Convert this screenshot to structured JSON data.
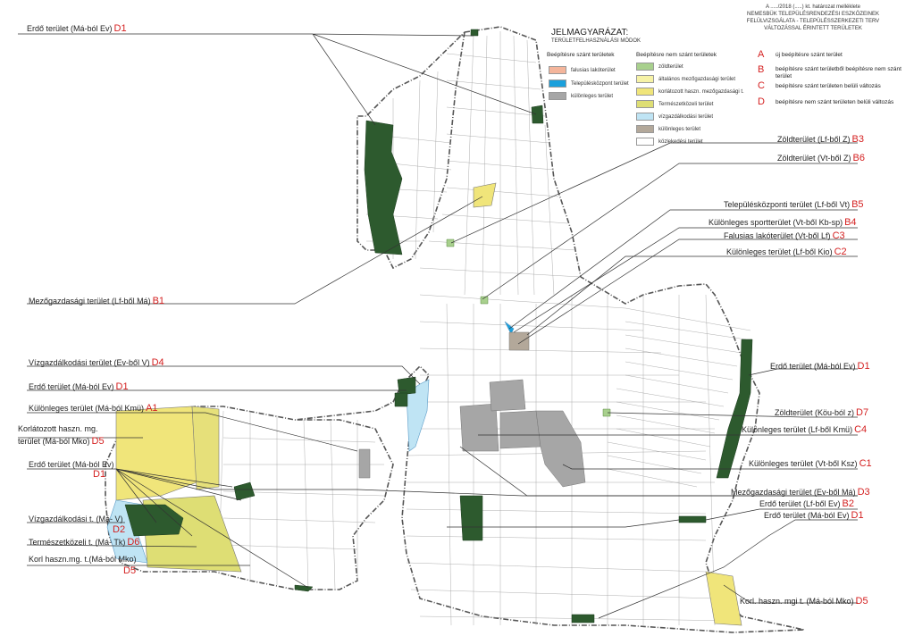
{
  "header": {
    "line1": "A ...../2018 (.....) kt. határozat melléklete",
    "line2": "NEMESBÜK TELEPÜLÉSRENDEZÉSI ESZKÖZEINEK",
    "line3": "FELÜLVIZSGÁLATA - TELEPÜLÉSSZERKEZETI TERV",
    "line4": "VÁLTOZÁSSAL ÉRINTETT TERÜLETEK"
  },
  "legend": {
    "title": "JELMAGYARÁZAT:",
    "subtitle": "TERÜLETFELHASZNÁLÁSI MÓDOK",
    "built_heading": "Beépítésre szánt területek",
    "unbuilt_heading": "Beépítésre nem szánt területek",
    "built_items": [
      {
        "label": "falusias lakóterület",
        "color": "#f4b59b"
      },
      {
        "label": "Településközpont terület",
        "color": "#1aa0dc"
      },
      {
        "label": "különleges terület",
        "color": "#a6a6a6"
      }
    ],
    "unbuilt_items": [
      {
        "label": "zöldterület",
        "color": "#a8d08d"
      },
      {
        "label": "általános mezőgazdasági terület",
        "color": "#f6f2a6"
      },
      {
        "label": "korlátozott haszn. mezőgazdasági t.",
        "color": "#f0e57a"
      },
      {
        "label": "Természetközeli terület",
        "color": "#dede74"
      },
      {
        "label": "vízgazdálkodási terület",
        "color": "#bfe4f4"
      },
      {
        "label": "különleges terület",
        "color": "#b3a89a"
      },
      {
        "label": "közlekedési terület",
        "color": "#ffffff"
      }
    ],
    "change_types": [
      {
        "key": "A",
        "text": "új beépítésre szánt terület"
      },
      {
        "key": "B",
        "text": "beépítésre szánt területből beépítésre nem szánt terület"
      },
      {
        "key": "C",
        "text": "beépítésre szánt területen belüli változás"
      },
      {
        "key": "D",
        "text": "beépítésre nem szánt területen belüli változás"
      }
    ]
  },
  "annotations": [
    {
      "text": "Erdő terület (Má-ból Ev)",
      "code": "D1"
    },
    {
      "text": "Mezőgazdasági terület (Lf-ből Má)",
      "code": "B1"
    },
    {
      "text": "Vízgazdálkodási terület (Ev-ből V)",
      "code": "D4"
    },
    {
      "text": "Erdő terület (Má-ból Ev)",
      "code": "D1"
    },
    {
      "text": "Különleges terület (Má-ból Kmü)",
      "code": "A1"
    },
    {
      "text": "Korlátozott haszn. mg.",
      "code": ""
    },
    {
      "text": "terület (Má-ból Mko)",
      "code": "D5"
    },
    {
      "text": "Erdő terület (Má-ból Ev)",
      "code": "D1"
    },
    {
      "text": "Vízgazdálkodási t. (Má- V)",
      "code": "D2"
    },
    {
      "text": "Természetközeli t. (Má- Tk)",
      "code": "D6"
    },
    {
      "text": "Korl haszn.mg. t.(Má-ból Mko)",
      "code": "D5"
    },
    {
      "text": "Zöldterület (Lf-ből Z)",
      "code": "B3"
    },
    {
      "text": "Zöldterület (Vt-ből Z)",
      "code": "B6"
    },
    {
      "text": "Településközponti terület (Lf-ből Vt)",
      "code": "B5"
    },
    {
      "text": "Különleges sportterület (Vt-ből Kb-sp)",
      "code": "B4"
    },
    {
      "text": "Falusias lakóterület (Vt-ből Lf)",
      "code": "C3"
    },
    {
      "text": "Különleges terület (Lf-ből Kio)",
      "code": "C2"
    },
    {
      "text": "Erdő terület (Má-ból Ev)",
      "code": "D1"
    },
    {
      "text": "Zöldterület (Köu-ból z)",
      "code": "D7"
    },
    {
      "text": "Különleges terület (Lf-ből Kmü)",
      "code": "C4"
    },
    {
      "text": "Különleges terület (Vt-ből Ksz)",
      "code": "C1"
    },
    {
      "text": "Mezőgazdasági terület (Ev-ből Má)",
      "code": "D3"
    },
    {
      "text": "Erdő terület (Lf-ből Ev)",
      "code": "B2"
    },
    {
      "text": "Erdő terület (Má-ból Ev)",
      "code": "D1"
    },
    {
      "text": "Korl. haszn. mgi t. (Má-ból Mko)",
      "code": "D5"
    }
  ],
  "colors": {
    "forest": "#2d5a2e",
    "boundary": "#555555",
    "parcel_line": "#9a9a9a",
    "special": "#a6a6a6",
    "restricted_agri": "#f0e57a",
    "natural": "#dede74",
    "water": "#bfe4f4",
    "code_red": "#d42020"
  }
}
